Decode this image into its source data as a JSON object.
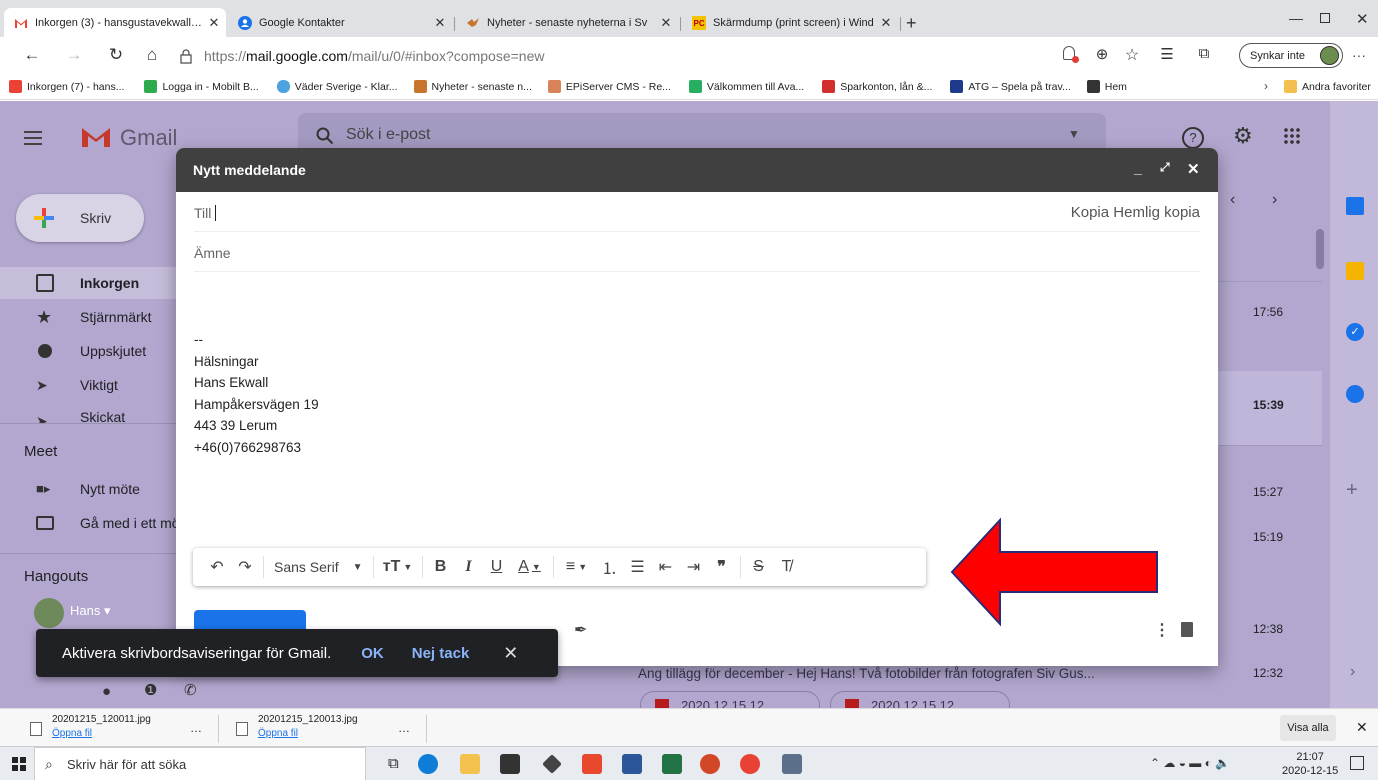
{
  "browser": {
    "tabs": [
      {
        "title": "Inkorgen (3) - hansgustavekwall@",
        "icon": "gmail-icon",
        "active": true
      },
      {
        "title": "Google Kontakter",
        "icon": "contacts-icon"
      },
      {
        "title": "Nyheter - senaste nyheterna i Sv",
        "icon": "news-icon"
      },
      {
        "title": "Skärmdump (print screen) i Wind",
        "icon": "pc-icon"
      }
    ],
    "url_prefix": "https://",
    "url_host": "mail.google.com",
    "url_rest": "/mail/u/0/#inbox?compose=new",
    "sync_label": "Synkar inte",
    "more": "···",
    "favorites": [
      {
        "label": "Inkorgen (7) - hans...",
        "color": "#ea4335"
      },
      {
        "label": "Logga in - Mobilt B...",
        "color": "#2eaa4f"
      },
      {
        "label": "Väder Sverige - Klar...",
        "color": "#4da3e0"
      },
      {
        "label": "Nyheter - senaste n...",
        "color": "#c8762e"
      },
      {
        "label": "EPiServer CMS - Re...",
        "color": "#d9835a"
      },
      {
        "label": "Välkommen till Ava...",
        "color": "#27ae60"
      },
      {
        "label": "Sparkonton, lån &...",
        "color": "#d32f2f"
      },
      {
        "label": "ATG – Spela på trav...",
        "color": "#1e3a8a"
      },
      {
        "label": "Hem",
        "color": "#333333"
      }
    ],
    "other_favorites": "Andra favoriter"
  },
  "gmail": {
    "logo_text": "Gmail",
    "search_placeholder": "Sök i e-post",
    "compose_button": "Skriv",
    "nav": [
      {
        "label": "Inkorgen",
        "icon": "inbox-icon",
        "selected": true
      },
      {
        "label": "Stjärnmärkt",
        "icon": "star-icon"
      },
      {
        "label": "Uppskjutet",
        "icon": "clock-icon"
      },
      {
        "label": "Viktigt",
        "icon": "important-icon"
      },
      {
        "label": "Skickat",
        "icon": "send-icon"
      }
    ],
    "meet_heading": "Meet",
    "meet_items": [
      {
        "label": "Nytt möte",
        "icon": "video-icon"
      },
      {
        "label": "Gå med i ett möte",
        "icon": "keyboard-icon"
      }
    ],
    "hangouts_heading": "Hangouts",
    "hangouts_user": "Hans",
    "times": [
      "17:56",
      "15:39",
      "15:27",
      "15:19",
      "12:38",
      "12:32"
    ],
    "visible_mail": "Ang tillägg för december - Hej Hans! Två fotobilder från fotografen Siv Gus...",
    "attachments": [
      "2020 12 15 12...",
      "2020 12 15 12..."
    ]
  },
  "compose": {
    "title": "Nytt meddelande",
    "to_label": "Till",
    "cc_label": "Kopia",
    "bcc_label": "Hemlig kopia",
    "subject_placeholder": "Ämne",
    "signature": [
      "--",
      "Hälsningar",
      "Hans Ekwall",
      "Hampåkersvägen 19",
      "443 39  Lerum",
      "+46(0)766298763"
    ],
    "font_name": "Sans Serif"
  },
  "annotation": {
    "arrow_color": "#ff0000"
  },
  "snackbar": {
    "message": "Aktivera skrivbordsaviseringar för Gmail.",
    "ok": "OK",
    "no": "Nej tack"
  },
  "downloads": {
    "items": [
      {
        "name": "20201215_120011.jpg",
        "action": "Öppna fil"
      },
      {
        "name": "20201215_120013.jpg",
        "action": "Öppna fil"
      }
    ],
    "show_all": "Visa alla"
  },
  "taskbar": {
    "search_placeholder": "Skriv här för att söka",
    "time": "21:07",
    "date": "2020-12-15"
  }
}
